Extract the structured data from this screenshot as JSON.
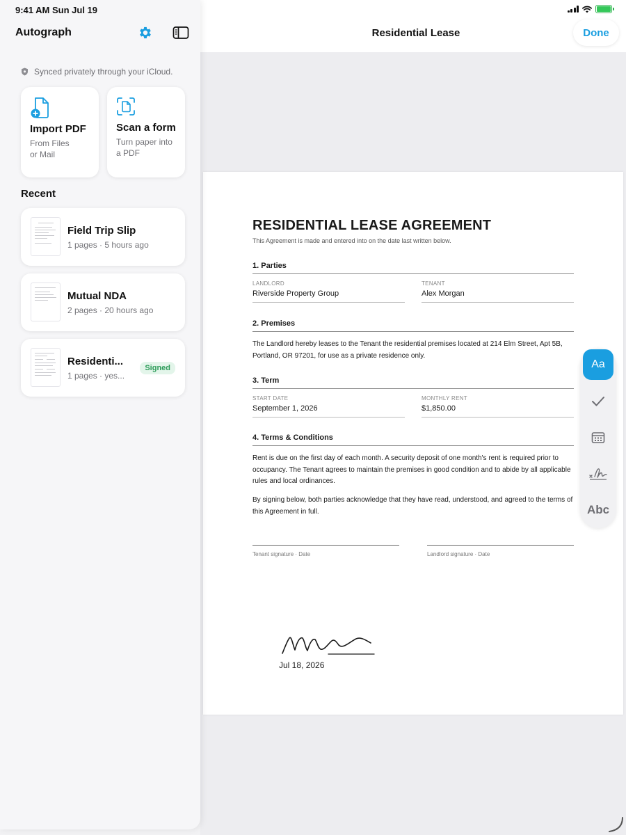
{
  "status_bar": {
    "time": "9:41 AM  Sun Jul 19"
  },
  "sidebar": {
    "app_title": "Autograph",
    "sync_note": "Synced privately through your iCloud.",
    "actions": [
      {
        "title": "Import PDF",
        "subtitle_line1": "From Files",
        "subtitle_line2": "or Mail"
      },
      {
        "title": "Scan a form",
        "subtitle_line1": "Turn paper into",
        "subtitle_line2": "a PDF"
      }
    ],
    "recent_heading": "Recent",
    "recent_docs": [
      {
        "title": "Field Trip Slip",
        "meta": "1 pages · 5 hours ago"
      },
      {
        "title": "Mutual NDA",
        "meta": "2 pages · 20 hours ago"
      },
      {
        "title": "Residenti...",
        "meta": "1 pages · yes...",
        "badge": "Signed"
      }
    ]
  },
  "top_bar": {
    "title": "Residential Lease",
    "done_label": "Done"
  },
  "document": {
    "title": "RESIDENTIAL LEASE AGREEMENT",
    "intro": "This Agreement is made and entered into on the date last written below.",
    "sections": {
      "parties": {
        "heading": "1. Parties",
        "landlord_label": "LANDLORD",
        "landlord_value": "Riverside Property Group",
        "tenant_label": "TENANT",
        "tenant_value": "Alex Morgan"
      },
      "premises": {
        "heading": "2. Premises",
        "text": "The Landlord hereby leases to the Tenant the residential premises located at 214 Elm Street, Apt 5B, Portland, OR 97201, for use as a private residence only."
      },
      "term": {
        "heading": "3. Term",
        "start_label": "START DATE",
        "start_value": "September 1, 2026",
        "rent_label": "MONTHLY RENT",
        "rent_value": "$1,850.00"
      },
      "terms": {
        "heading": "4. Terms & Conditions",
        "para1": "Rent is due on the first day of each month. A security deposit of one month's rent is required prior to occupancy. The Tenant agrees to maintain the premises in good condition and to abide by all applicable rules and local ordinances.",
        "para2": "By signing below, both parties acknowledge that they have read, understood, and agreed to the terms of this Agreement in full."
      }
    },
    "signatures": {
      "tenant_caption": "Tenant signature  ·  Date",
      "landlord_caption": "Landlord signature  ·  Date"
    },
    "placed_signature_date": "Jul 18, 2026"
  },
  "tools": {
    "text_tool_label": "Aa",
    "abc_label": "Abc"
  },
  "colors": {
    "accent": "#1a9ee0",
    "signed_badge_bg": "#e3f5ea",
    "signed_badge_text": "#2e9c5a"
  }
}
